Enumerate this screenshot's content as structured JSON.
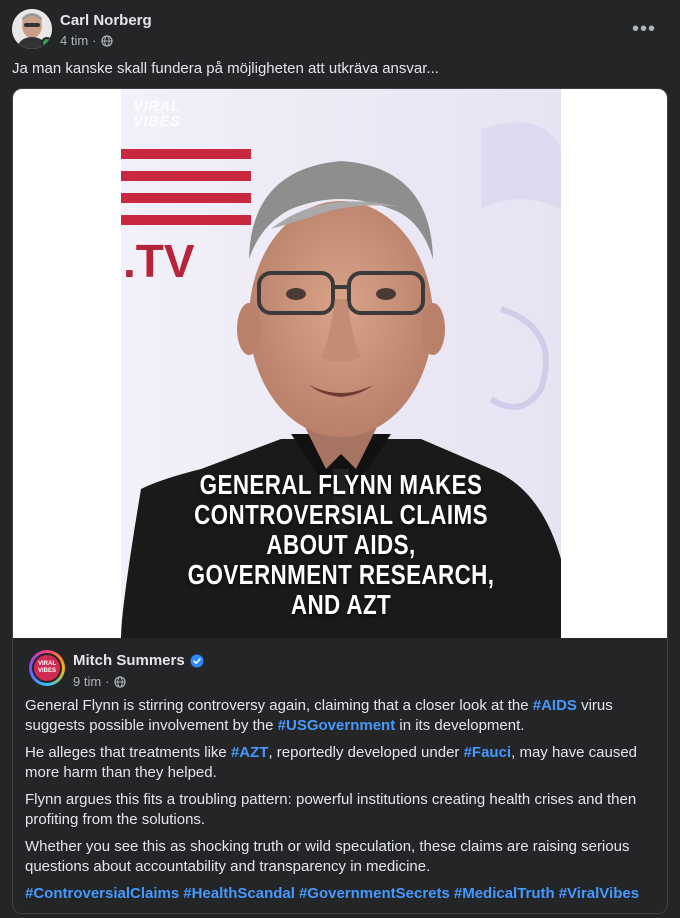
{
  "post": {
    "author": "Carl Norberg",
    "time": "4 tim",
    "separator": "·",
    "privacy_icon": "globe-icon",
    "more_icon": "more-options-icon",
    "more_label": "•••",
    "caption": "Ja man kanske skall fundera på möjligheten att utkräva ansvar..."
  },
  "media": {
    "watermark_line1": "VIRAL",
    "watermark_line2": "VIBES",
    "backdrop_text": ".TV",
    "headline_line1": "GENERAL FLYNN MAKES",
    "headline_line2": "CONTROVERSIAL CLAIMS ABOUT AIDS,",
    "headline_line3": "GOVERNMENT RESEARCH, AND AZT"
  },
  "shared": {
    "author": "Mitch Summers",
    "avatar_text": "VIRAL VIBES",
    "verified_icon": "verified-badge-icon",
    "time": "9 tim",
    "separator": "·",
    "privacy_icon": "globe-icon",
    "p1": {
      "a": "General Flynn is stirring controversy again, claiming that a closer look at the ",
      "tag1": "#AIDS",
      "b": " virus suggests possible involvement by the ",
      "tag2": "#USGovernment",
      "c": " in its development."
    },
    "p2": {
      "a": "He alleges that treatments like ",
      "tag1": "#AZT",
      "b": ", reportedly developed under ",
      "tag2": "#Fauci",
      "c": ", may have caused more harm than they helped."
    },
    "p3": "Flynn argues this fits a troubling pattern: powerful institutions creating health crises and then profiting from the solutions.",
    "p4": "Whether you see this as shocking truth or wild speculation, these claims are raising serious questions about accountability and transparency in medicine.",
    "hashtags": [
      "#ControversialClaims",
      "#HealthScandal",
      "#GovernmentSecrets",
      "#MedicalTruth",
      "#ViralVibes"
    ]
  },
  "colors": {
    "background": "#242526",
    "text": "#e4e6eb",
    "secondary_text": "#b0b3b8",
    "link": "#4599ff",
    "online": "#31a24c",
    "verified": "#2d88ff"
  }
}
